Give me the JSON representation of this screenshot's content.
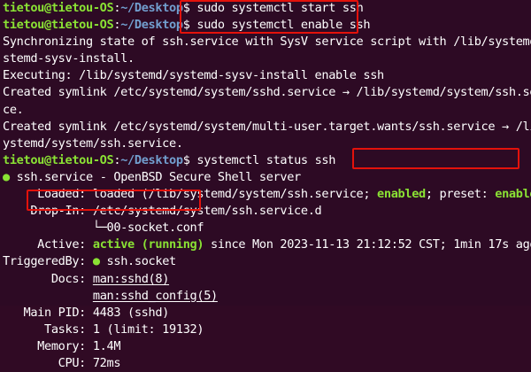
{
  "prompt": {
    "user": "tietou@tietou-OS",
    "sep": ":",
    "path": "~/Desktop",
    "symbol": "$ "
  },
  "commands": {
    "start": "sudo systemctl start ssh",
    "enable": "sudo systemctl enable ssh",
    "status": "systemctl status ssh"
  },
  "output": {
    "sync_1": "Synchronizing state of ssh.service with SysV service script with /lib/systemd/sy",
    "sync_2": "stemd-sysv-install.",
    "exec": "Executing: /lib/systemd/systemd-sysv-install enable ssh",
    "symlink1_1": "Created symlink /etc/systemd/system/sshd.service → /lib/systemd/system/ssh.servi",
    "symlink1_2": "ce.",
    "symlink2_1": "Created symlink /etc/systemd/system/multi-user.target.wants/ssh.service → /lib/s",
    "symlink2_2": "ystemd/system/ssh.service."
  },
  "status": {
    "dot": "●",
    "service_line": " ssh.service - OpenBSD Secure Shell server",
    "loaded_pre": "     Loaded: loaded (/lib/systemd/system/ssh.service; ",
    "loaded_enabled": "enabled",
    "loaded_mid": "; preset: ",
    "loaded_preset": "enabled",
    "loaded_end": ")",
    "dropin_pre": "    Drop-In: /etc/systemd/system/ssh.service.d",
    "dropin_tree": "             └─00-socket.conf",
    "active_label": "     Active: ",
    "active_value": "active (running)",
    "active_rest": " since Mon 2023-11-13 21:12:52 CST; 1min 17s ago",
    "triggered_label": "TriggeredBy: ",
    "triggered_value": " ssh.socket",
    "docs_label": "       Docs: ",
    "docs_1": "man:sshd(8)",
    "docs_indent": "             ",
    "docs_2": "man:sshd_config(5)",
    "mainpid": "   Main PID: 4483 (sshd)",
    "tasks": "      Tasks: 1 (limit: 19132)",
    "memory": "     Memory: 1.4M",
    "cpu": "        CPU: 72ms"
  },
  "colors": {
    "background": "#2d0a24",
    "prompt_user": "#8ae234",
    "prompt_path": "#729fcf",
    "status_green": "#8ae234",
    "highlight_box": "#e3120b"
  }
}
